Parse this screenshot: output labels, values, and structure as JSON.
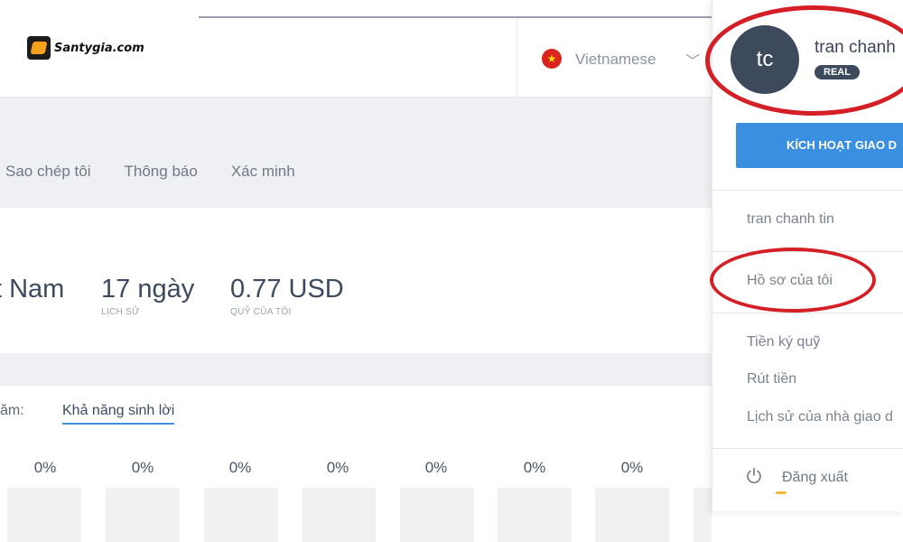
{
  "header": {
    "logo_text": "Santygia.com",
    "language": "Vietnamese",
    "flag_icon": "vietnam-flag-icon",
    "chevron_icon": "chevron-down-icon"
  },
  "tabs": [
    {
      "label": "Sao chép tôi"
    },
    {
      "label": "Thông báo"
    },
    {
      "label": "Xác minh"
    }
  ],
  "stats": [
    {
      "value": "t Nam",
      "label": ""
    },
    {
      "value": "17 ngày",
      "label": "LỊCH SỬ"
    },
    {
      "value": "0.77 USD",
      "label": "QUỸ CỦA TÔI"
    }
  ],
  "profit": {
    "year_label": "ăm:",
    "link_label": "Khả năng sinh lời",
    "percentages": [
      "0%",
      "0%",
      "0%",
      "0%",
      "0%",
      "0%",
      "0%"
    ]
  },
  "user_menu": {
    "avatar_initials": "tc",
    "user_name": "tran chanh",
    "account_badge": "REAL",
    "activate_button": "KÍCH HOẠT GIAO D",
    "account_name": "tran chanh tin",
    "items": [
      {
        "label": "Hồ sơ của tôi"
      },
      {
        "label": "Tiền ký quỹ"
      },
      {
        "label": "Rút tiền"
      },
      {
        "label": "Lịch sử của nhà giao d"
      }
    ],
    "logout_label": "Đăng xuất",
    "logout_icon": "power-icon"
  },
  "annotation_color": "#d41f26",
  "accent_color": "#3b8fe0"
}
